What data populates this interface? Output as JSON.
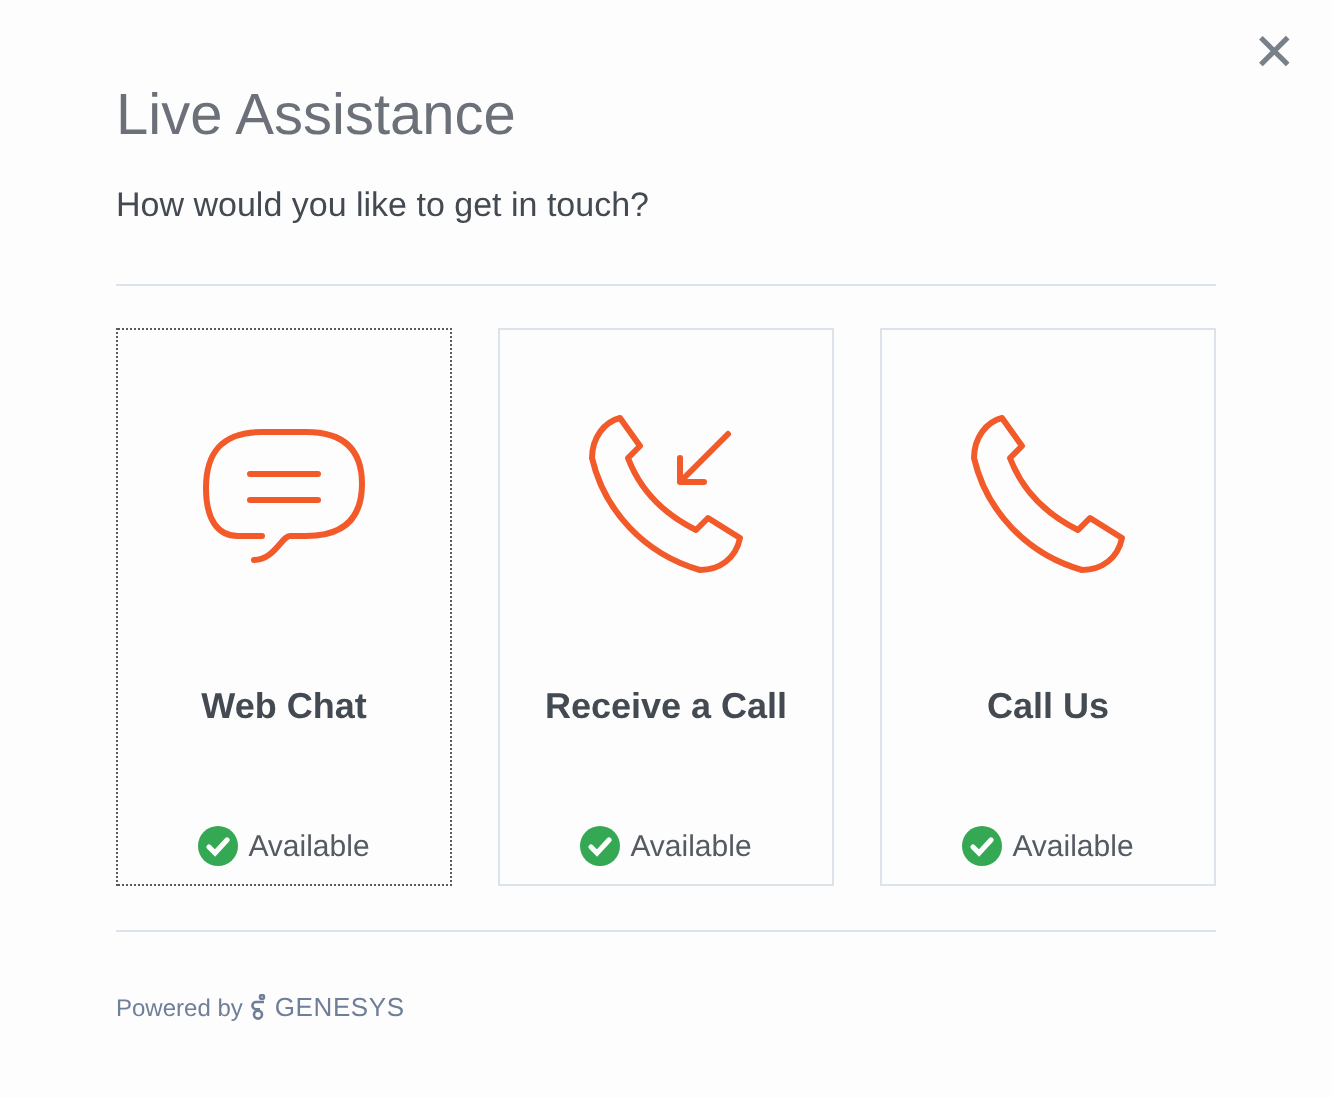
{
  "dialog": {
    "title": "Live Assistance",
    "close": "✕",
    "question": "How would you like to get in touch?"
  },
  "options": [
    {
      "kind": "chat",
      "label": "Web Chat",
      "status": "Available",
      "available": true,
      "selected": true
    },
    {
      "kind": "callback",
      "label": "Receive a Call",
      "status": "Available",
      "available": true,
      "selected": false
    },
    {
      "kind": "call",
      "label": "Call Us",
      "status": "Available",
      "available": true,
      "selected": false
    }
  ],
  "footer": {
    "powered_by": "Powered by",
    "brand": "GENESYS"
  }
}
